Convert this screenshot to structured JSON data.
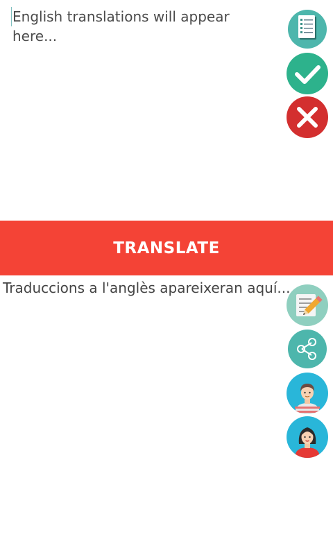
{
  "source": {
    "placeholder": "English translations will appear here..."
  },
  "translate_button": {
    "label": "TRANSLATE"
  },
  "target": {
    "text": "Traduccions a l'anglès apareixeran aquí..."
  },
  "icons": {
    "top": [
      "checklist-icon",
      "check-icon",
      "close-icon"
    ],
    "bottom": [
      "edit-note-icon",
      "share-icon",
      "male-voice-icon",
      "female-voice-icon"
    ]
  },
  "colors": {
    "accent_red": "#f44336",
    "teal": "#4db6ac",
    "green": "#2db28c",
    "close_red": "#d32f2f",
    "sky_blue": "#29b6d9"
  }
}
